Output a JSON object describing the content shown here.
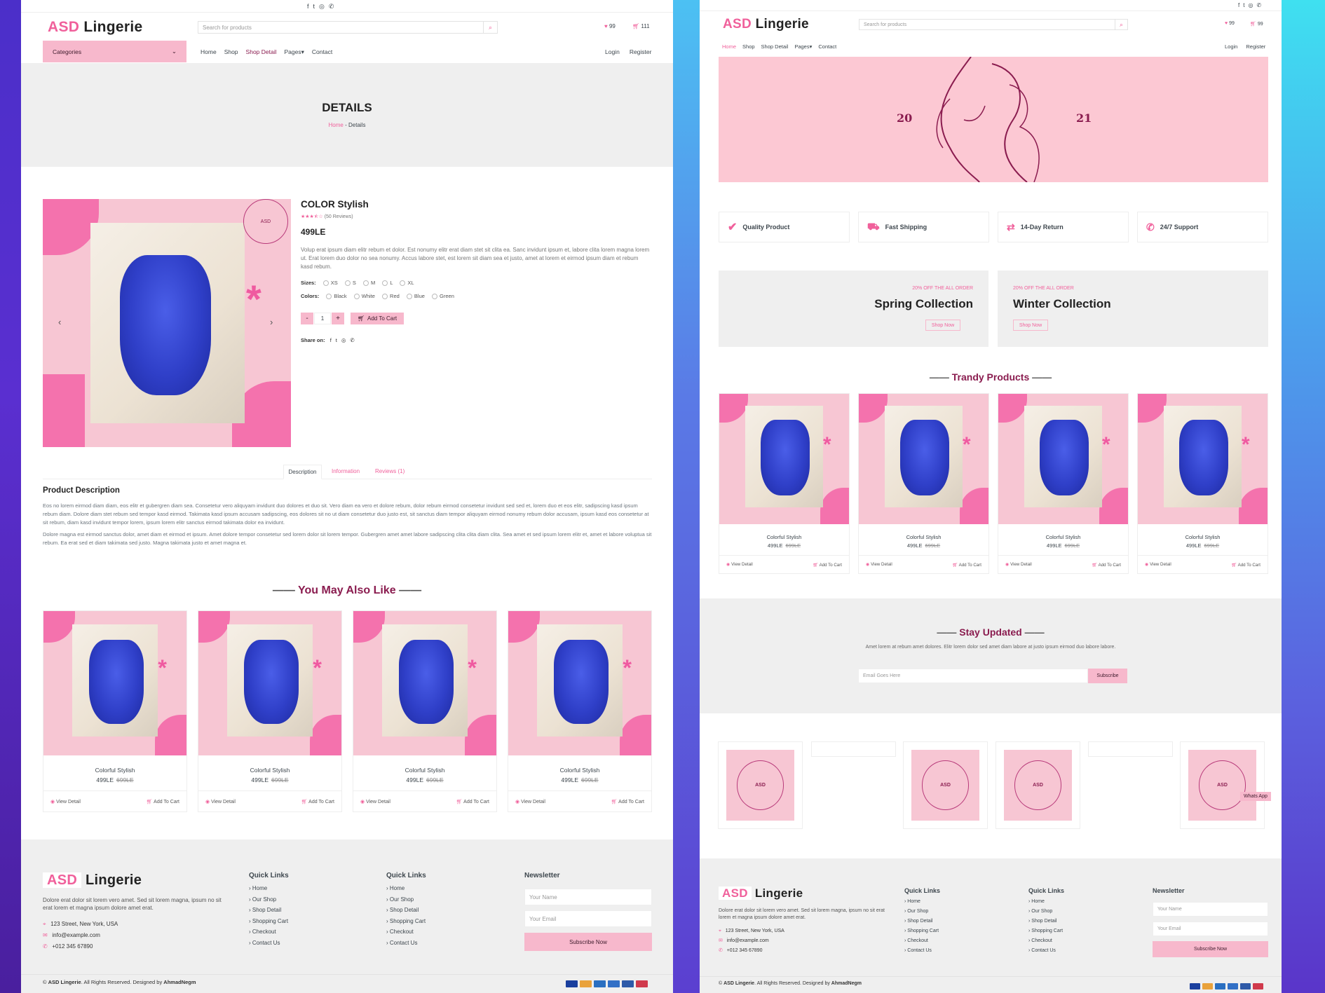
{
  "left": {
    "logo": {
      "a": "ASD",
      "b": "Lingerie"
    },
    "search": {
      "placeholder": "Search for products"
    },
    "wish_count": "99",
    "cart_count": "111",
    "categories": "Categories",
    "nav": [
      "Home",
      "Shop",
      "Shop Detail",
      "Pages",
      "Contact"
    ],
    "login": "Login",
    "register": "Register",
    "hero": {
      "title": "DETAILS",
      "crumb_home": "Home",
      "crumb_sep": "-",
      "crumb_cur": "Details"
    },
    "product": {
      "title": "COLOR Stylish",
      "reviews": "(50 Reviews)",
      "price": "499LE",
      "rating": 3.5,
      "desc": "Volup erat ipsum diam elitr rebum et dolor. Est nonumy elitr erat diam stet sit clita ea. Sanc invidunt ipsum et, labore clita lorem magna lorem ut. Erat lorem duo dolor no sea nonumy. Accus labore stet, est lorem sit diam sea et justo, amet at lorem et eirmod ipsum diam et rebum kasd rebum.",
      "sizes_label": "Sizes:",
      "sizes": [
        "XS",
        "S",
        "M",
        "L",
        "XL"
      ],
      "colors_label": "Colors:",
      "colors": [
        "Black",
        "White",
        "Red",
        "Blue",
        "Green"
      ],
      "qty": "1",
      "minus": "-",
      "plus": "+",
      "add": "Add To Cart",
      "share": "Share on:"
    },
    "tabs": [
      "Description",
      "Information",
      "Reviews (1)"
    ],
    "desc_title": "Product Description",
    "desc_p1": "Eos no lorem eirmod diam diam, eos elitr et gubergren diam sea. Consetetur vero aliquyam invidunt duo dolores et duo sit. Vero diam ea vero et dolore rebum, dolor rebum eirmod consetetur invidunt sed sed et, lorem duo et eos elitr, sadipscing kasd ipsum rebum diam. Dolore diam stet rebum sed tempor kasd eirmod. Takimata kasd ipsum accusam sadipscing, eos dolores sit no ut diam consetetur duo justo est, sit sanctus diam tempor aliquyam eirmod nonumy rebum dolor accusam, ipsum kasd eos consetetur at sit rebum, diam kasd invidunt tempor lorem, ipsum lorem elitr sanctus eirmod takimata dolor ea invidunt.",
    "desc_p2": "Dolore magna est eirmod sanctus dolor, amet diam et eirmod et ipsum. Amet dolore tempor consetetur sed lorem dolor sit lorem tempor. Gubergren amet amet labore sadipscing clita clita diam clita. Sea amet et sed ipsum lorem elitr et, amet et labore voluptua sit rebum. Ea erat sed et diam takimata sed justo. Magna takimata justo et amet magna et.",
    "also_title": "You May Also Like",
    "cards": [
      {
        "name": "Colorful Stylish",
        "price": "499LE",
        "old": "699LE"
      },
      {
        "name": "Colorful Stylish",
        "price": "499LE",
        "old": "699LE"
      },
      {
        "name": "Colorful Stylish",
        "price": "499LE",
        "old": "699LE"
      },
      {
        "name": "Colorful Stylish",
        "price": "499LE",
        "old": "699LE"
      }
    ],
    "view": "View Detail",
    "addcart": "Add To Cart",
    "footer": {
      "about": "Dolore erat dolor sit lorem vero amet. Sed sit lorem magna, ipsum no sit erat lorem et magna ipsum dolore amet erat.",
      "addr": "123 Street, New York, USA",
      "email": "info@example.com",
      "phone": "+012 345 67890",
      "ql_title": "Quick Links",
      "links": [
        "Home",
        "Our Shop",
        "Shop Detail",
        "Shopping Cart",
        "Checkout",
        "Contact Us"
      ],
      "news": "Newsletter",
      "name_ph": "Your Name",
      "email_ph": "Your Email",
      "subscribe": "Subscribe Now",
      "copy_a": "© ",
      "copy_brand": "ASD Lingerie",
      "copy_b": ". All Rights Reserved. Designed by ",
      "copy_author": "AhmadNegm"
    }
  },
  "right": {
    "logo": {
      "a": "ASD",
      "b": "Lingerie"
    },
    "search": {
      "placeholder": "Search for products"
    },
    "wish_count": "99",
    "cart_count": "99",
    "nav": [
      "Home",
      "Shop",
      "Shop Detail",
      "Pages",
      "Contact"
    ],
    "login": "Login",
    "register": "Register",
    "banner": {
      "left": "20",
      "right": "21"
    },
    "features": [
      "Quality Product",
      "Fast Shipping",
      "14-Day Return",
      "24/7 Support"
    ],
    "collections": [
      {
        "off": "20% OFF THE ALL ORDER",
        "title": "Spring Collection",
        "btn": "Shop Now"
      },
      {
        "off": "20% OFF THE ALL ORDER",
        "title": "Winter Collection",
        "btn": "Shop Now"
      }
    ],
    "trendy_title": "Trandy Products",
    "cards": [
      {
        "name": "Colorful Stylish",
        "price": "499LE",
        "old": "699LE"
      },
      {
        "name": "Colorful Stylish",
        "price": "499LE",
        "old": "699LE"
      },
      {
        "name": "Colorful Stylish",
        "price": "499LE",
        "old": "699LE"
      },
      {
        "name": "Colorful Stylish",
        "price": "499LE",
        "old": "699LE"
      }
    ],
    "view": "View Detail",
    "addcart": "Add To Cart",
    "stay": {
      "title": "Stay Updated",
      "text": "Amet lorem at rebum amet dolores. Elitr lorem dolor sed amet diam labore at justo ipsum eirmod duo labore labore.",
      "ph": "Email Goes Here",
      "btn": "Subscribe"
    },
    "whatsapp": "Whats App",
    "footer": {
      "about": "Dolore erat dolor sit lorem vero amet. Sed sit lorem magna, ipsum no sit erat lorem et magna ipsum dolore amet erat.",
      "addr": "123 Street, New York, USA",
      "email": "info@example.com",
      "phone": "+012 345 67890",
      "ql_title": "Quick Links",
      "links": [
        "Home",
        "Our Shop",
        "Shop Detail",
        "Shopping Cart",
        "Checkout",
        "Contact Us"
      ],
      "news": "Newsletter",
      "name_ph": "Your Name",
      "email_ph": "Your Email",
      "subscribe": "Subscribe Now",
      "copy_a": "© ",
      "copy_brand": "ASD Lingerie",
      "copy_b": ". All Rights Reserved. Designed by ",
      "copy_author": "AhmadNegm"
    }
  },
  "colors": {
    "accent": "#f0609b",
    "maroon": "#8a1c4f",
    "pink_bg": "#f7c6d3",
    "button": "#f7b8cc"
  }
}
